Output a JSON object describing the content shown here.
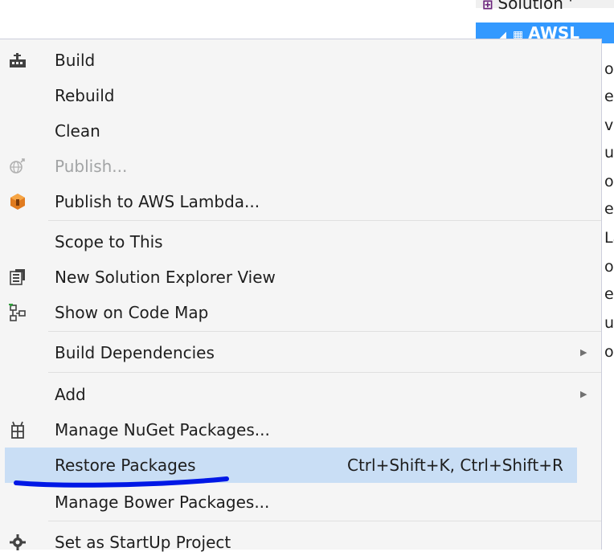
{
  "solution_explorer": {
    "solution_label": "Solution '",
    "selected_project": "AWSL",
    "partial_letters": [
      "o",
      "ef",
      "v",
      "u",
      "o",
      "ea",
      "La",
      "o",
      "ef",
      "u",
      "o"
    ]
  },
  "menu": {
    "items": [
      {
        "label": "Build",
        "icon": "build-icon"
      },
      {
        "label": "Rebuild"
      },
      {
        "label": "Clean"
      },
      {
        "label": "Publish...",
        "icon": "publish-icon",
        "disabled": true
      },
      {
        "label": "Publish to AWS Lambda...",
        "icon": "aws-lambda-icon"
      },
      {
        "label": "Scope to This"
      },
      {
        "label": "New Solution Explorer View",
        "icon": "new-view-icon"
      },
      {
        "label": "Show on Code Map",
        "icon": "code-map-icon"
      },
      {
        "label": "Build Dependencies",
        "submenu": true
      },
      {
        "label": "Add",
        "submenu": true
      },
      {
        "label": "Manage NuGet Packages...",
        "icon": "nuget-icon"
      },
      {
        "label": "Restore Packages",
        "shortcut": "Ctrl+Shift+K, Ctrl+Shift+R",
        "highlighted": true
      },
      {
        "label": "Manage Bower Packages..."
      },
      {
        "label": "Set as StartUp Project",
        "icon": "gear-icon"
      }
    ]
  },
  "colors": {
    "menu_background": "#f5f5f5",
    "highlight": "#c9def5",
    "selection": "#3399ff",
    "annotation": "#0018e6"
  }
}
